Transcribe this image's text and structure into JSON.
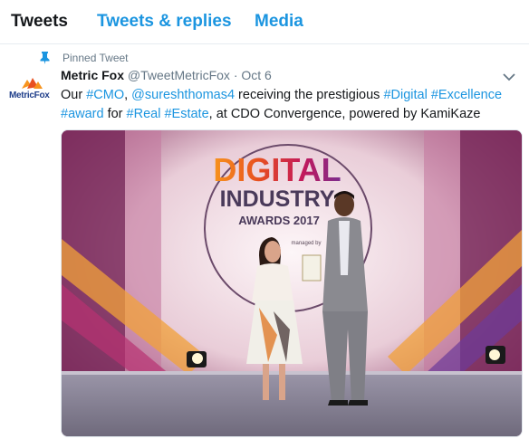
{
  "tabs": [
    {
      "label": "Tweets",
      "active": true
    },
    {
      "label": "Tweets & replies",
      "active": false
    },
    {
      "label": "Media",
      "active": false
    }
  ],
  "tweet": {
    "pinned_label": "Pinned Tweet",
    "author_name": "Metric Fox",
    "handle": "@TweetMetricFox",
    "separator": "·",
    "date": "Oct 6",
    "avatar_text": "MetricFox",
    "text": {
      "w1": "Our ",
      "cmo": "#CMO",
      "w2": ", ",
      "mention": "@sureshthomas4",
      "w3": " receiving the prestigious ",
      "digital": "#Digital",
      "w4": " ",
      "excellence": "#Excellence",
      "w5": " ",
      "award": "#award",
      "w6": " for ",
      "real": "#Real",
      "w7": " ",
      "estate": "#Estate",
      "w8": ", at CDO Convergence, powered by KamiKaze"
    },
    "media": {
      "backdrop_line1": "DIGITAL",
      "backdrop_line2": "INDUSTRY",
      "backdrop_line3": "AWARDS 2017",
      "backdrop_small": "managed by"
    }
  },
  "colors": {
    "link": "#1b95e0",
    "text": "#14171a",
    "muted": "#657786"
  },
  "icons": [
    "pin-icon",
    "chevron-down-icon"
  ]
}
